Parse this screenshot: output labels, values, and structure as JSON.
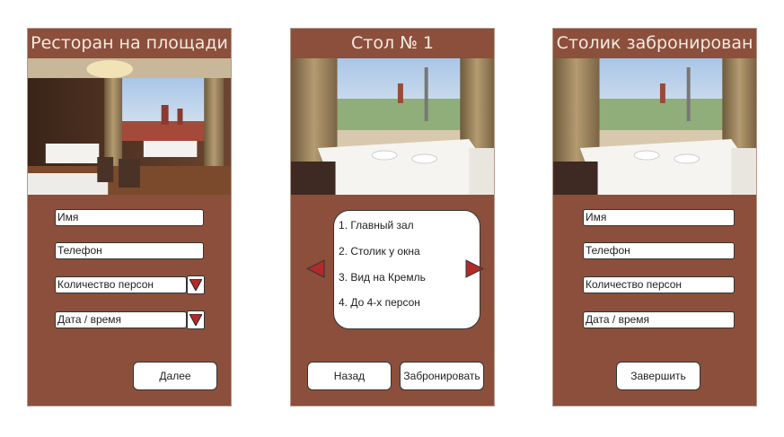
{
  "screens": [
    {
      "title": "Ресторан на площади",
      "fields": {
        "name": "Имя",
        "phone": "Телефон",
        "guests": "Количество персон",
        "datetime": "Дата / время"
      },
      "next_label": "Далее"
    },
    {
      "title": "Стол № 1",
      "features": [
        "1. Главный зал",
        "2. Столик у окна",
        "3. Вид на Кремль",
        "4. До 4-х персон"
      ],
      "back_label": "Назад",
      "book_label": "Забронировать"
    },
    {
      "title": "Столик забронирован",
      "fields": {
        "name": "Имя",
        "phone": "Телефон",
        "guests": "Количество персон",
        "datetime": "Дата / время"
      },
      "finish_label": "Завершить"
    }
  ],
  "colors": {
    "panel": "#8b4f3c",
    "title_text": "#f4e9e1",
    "arrow": "#b32a2a"
  },
  "icons": {
    "dropdown": "triangle-down-icon",
    "prev": "triangle-left-icon",
    "next": "triangle-right-icon"
  }
}
